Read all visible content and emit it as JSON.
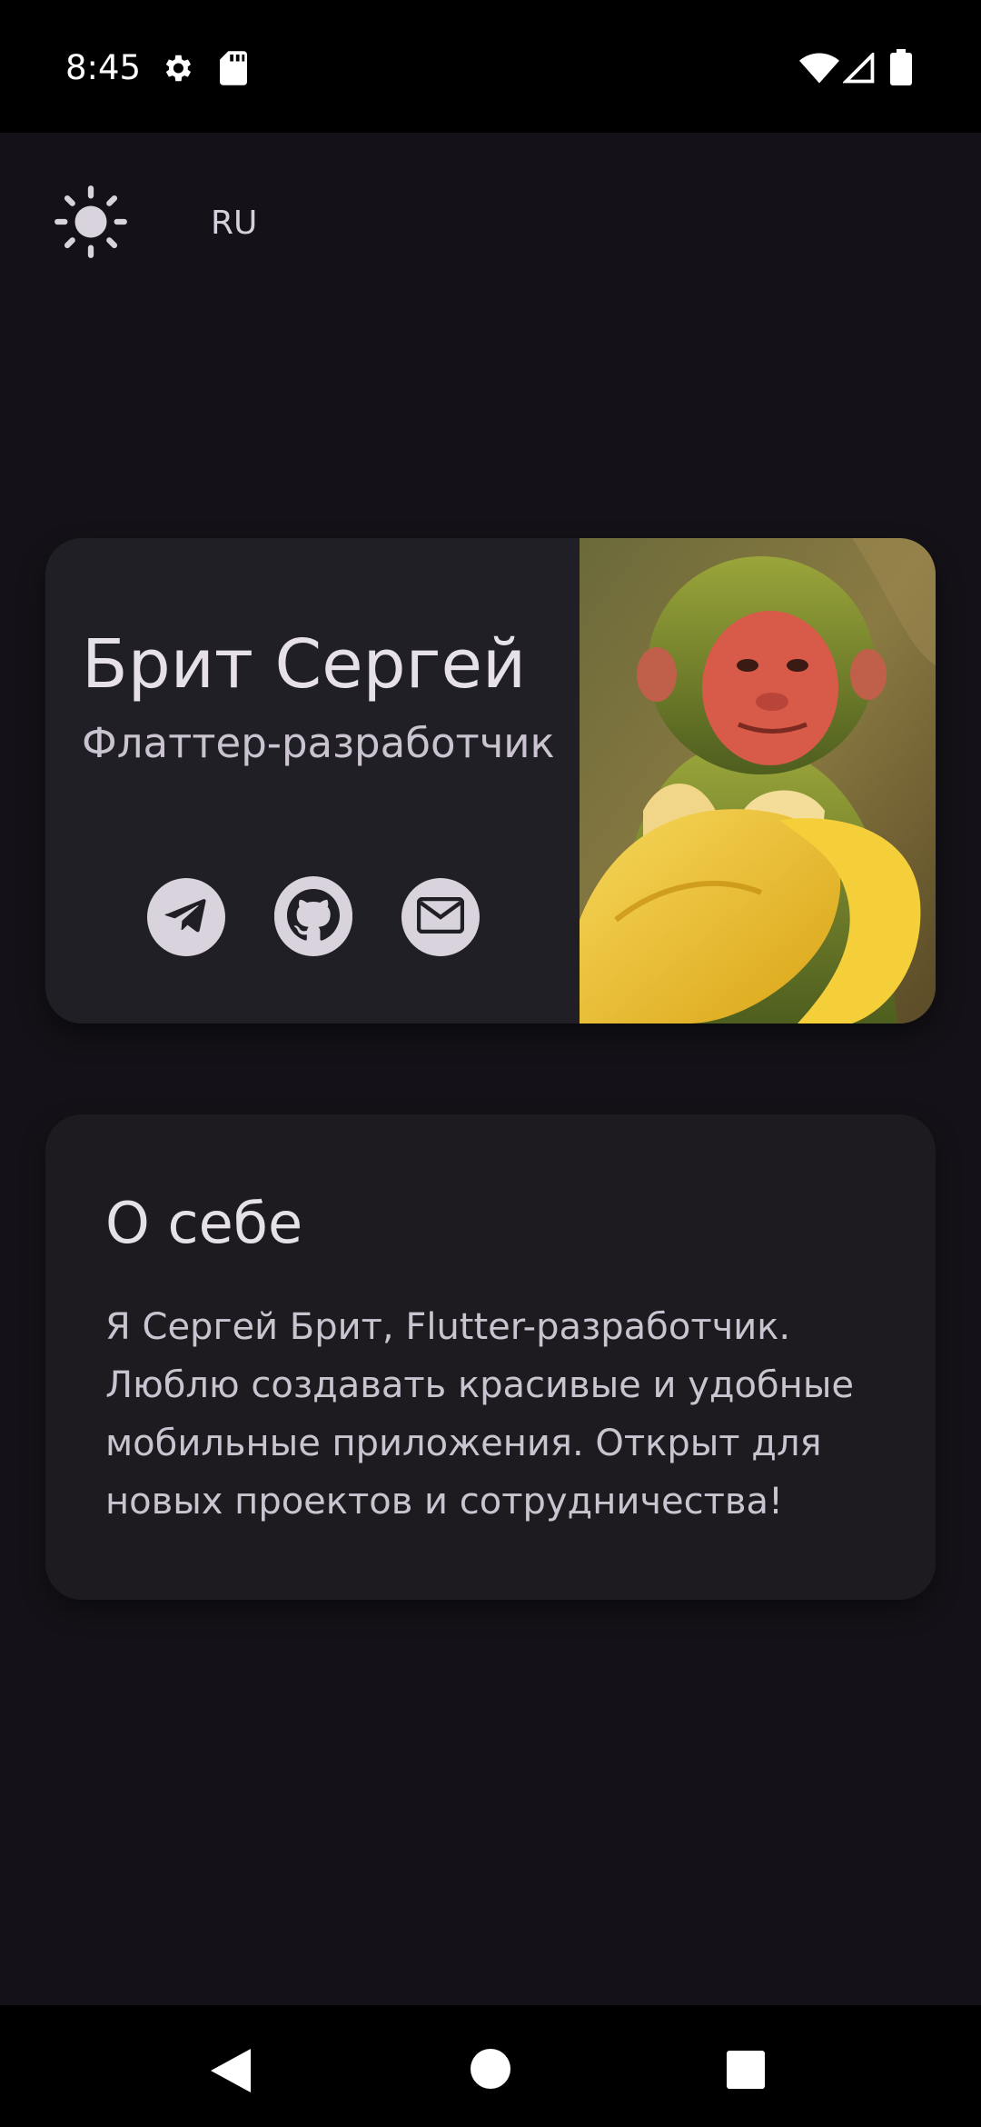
{
  "status_bar": {
    "time": "8:45",
    "icons": [
      "settings-icon",
      "sd-card-icon",
      "wifi-icon",
      "cell-signal-icon",
      "battery-icon"
    ]
  },
  "header": {
    "theme_icon": "sun-icon",
    "language": "RU"
  },
  "profile": {
    "name": "Брит Сергей",
    "role": "Флаттер-разработчик",
    "links": [
      {
        "name": "telegram",
        "icon": "telegram-icon"
      },
      {
        "name": "github",
        "icon": "github-icon"
      },
      {
        "name": "email",
        "icon": "mail-icon"
      }
    ],
    "photo": "monkey-with-banana-photo"
  },
  "about": {
    "title": "О себе",
    "text": "Я Сергей Брит, Flutter-разработчик. Люблю создавать красивые и удобные мобильные приложения. Открыт для новых проектов и сотрудничества!"
  },
  "nav_bar": {
    "buttons": [
      "back-icon",
      "home-icon",
      "recents-icon"
    ]
  },
  "colors": {
    "background": "#141218",
    "card": "#211f26",
    "about_card": "#1d1b20",
    "icon_circle": "#d8d3dd",
    "text_primary": "#e6e0e9",
    "text_secondary": "#cac4d0"
  }
}
